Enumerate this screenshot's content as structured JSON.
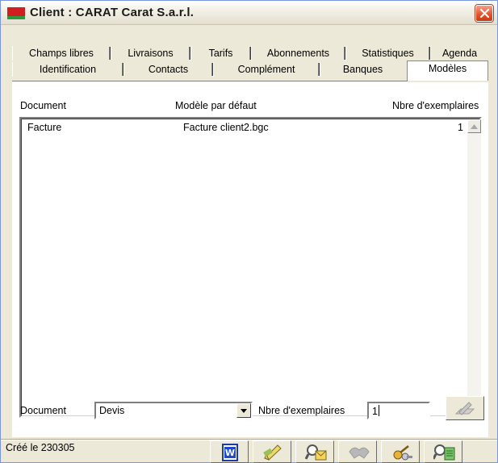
{
  "window": {
    "title": "Client : CARAT Carat S.a.r.l."
  },
  "tabs": {
    "row1": [
      "Champs libres",
      "Livraisons",
      "Tarifs",
      "Abonnements",
      "Statistiques",
      "Agenda"
    ],
    "row2": [
      "Identification",
      "Contacts",
      "Complément",
      "Banques",
      "Modèles"
    ],
    "active": "Modèles"
  },
  "list": {
    "columns": [
      "Document",
      "Modèle par défaut",
      "Nbre d'exemplaires"
    ],
    "rows": [
      {
        "document": "Facture",
        "model": "Facture client2.bgc",
        "copies": "1"
      }
    ]
  },
  "form": {
    "document_label": "Document",
    "document_value": "Devis",
    "copies_label": "Nbre d'exemplaires",
    "copies_value": "1"
  },
  "status": {
    "created": "Créé le 230305"
  },
  "toolbar": {
    "icons": [
      "word-icon",
      "edit-icon",
      "search-mail-icon",
      "handshake-icon",
      "keys-icon",
      "search-document-icon"
    ]
  },
  "colors": {
    "window_bg": "#ece9d8",
    "close_button": "#e0502b",
    "app_icon_red": "#d11f1f",
    "app_icon_green": "#2b9a3a"
  }
}
